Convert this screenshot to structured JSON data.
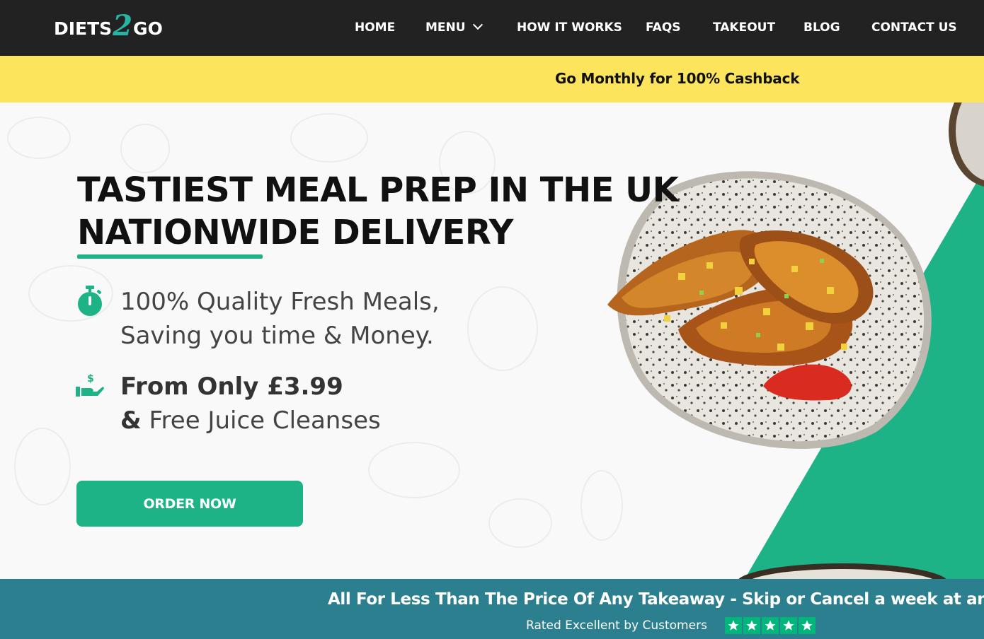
{
  "nav": {
    "logo": {
      "left": "DIETS",
      "mid": "2",
      "right": "GO"
    },
    "items": [
      {
        "label": "HOME"
      },
      {
        "label": "MENU"
      },
      {
        "label": "HOW IT WORKS"
      },
      {
        "label": "FAQS"
      },
      {
        "label": "TAKEOUT"
      },
      {
        "label": "BLOG"
      },
      {
        "label": "CONTACT US"
      }
    ],
    "icons": {
      "menu_dropdown": "chevron-down-icon"
    }
  },
  "promo": {
    "text": "Go Monthly for 100% Cashback"
  },
  "hero": {
    "title_line1": "TASTIEST MEAL PREP IN THE UK",
    "title_line2": "NATIONWIDE DELIVERY",
    "features": [
      {
        "icon": "stopwatch-icon",
        "line1": "100% Quality Fresh Meals,",
        "line2": "Saving you time & Money."
      },
      {
        "icon": "hand-money-icon",
        "line1": "From Only £3.99",
        "line2_prefix": "&",
        "line2": " Free Juice Cleanses"
      }
    ],
    "cta": "ORDER NOW",
    "image": "chicken-wings-plate-image"
  },
  "banner": {
    "ticker": "All For Less Than The Price Of Any Takeaway - Skip or Cancel a week at any ti",
    "rated": "Rated Excellent by Customers",
    "stars": 5
  },
  "colors": {
    "nav_bg": "#222222",
    "promo_bg": "#fce45c",
    "accent_green": "#1db386",
    "banner_bg": "#2b7f8e",
    "star_green": "#00b67a"
  }
}
